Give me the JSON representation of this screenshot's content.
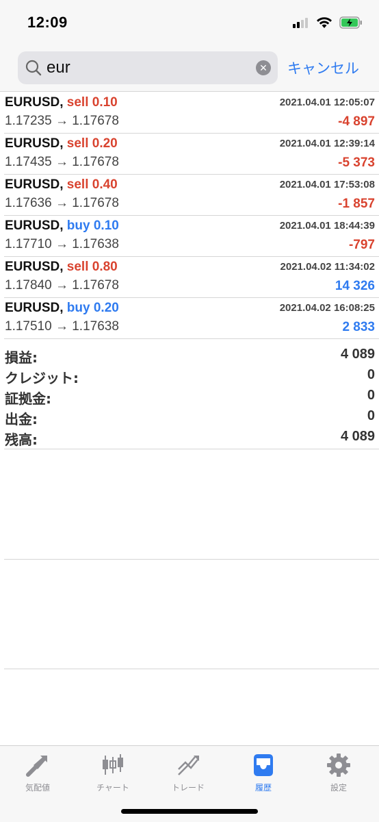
{
  "status_bar": {
    "time": "12:09"
  },
  "search": {
    "value": "eur",
    "placeholder": "",
    "cancel_label": "キャンセル"
  },
  "trades": [
    {
      "symbol": "EURUSD,",
      "type": "sell",
      "volume": "sell 0.10",
      "prices": "1.17235 → 1.17678",
      "time": "2021.04.01 12:05:07",
      "profit": "-4 897",
      "profit_sign": "neg"
    },
    {
      "symbol": "EURUSD,",
      "type": "sell",
      "volume": "sell 0.20",
      "prices": "1.17435 → 1.17678",
      "time": "2021.04.01 12:39:14",
      "profit": "-5 373",
      "profit_sign": "neg"
    },
    {
      "symbol": "EURUSD,",
      "type": "sell",
      "volume": "sell 0.40",
      "prices": "1.17636 → 1.17678",
      "time": "2021.04.01 17:53:08",
      "profit": "-1 857",
      "profit_sign": "neg"
    },
    {
      "symbol": "EURUSD,",
      "type": "buy",
      "volume": "buy 0.10",
      "prices": "1.17710 → 1.17638",
      "time": "2021.04.01 18:44:39",
      "profit": "-797",
      "profit_sign": "neg"
    },
    {
      "symbol": "EURUSD,",
      "type": "sell",
      "volume": "sell 0.80",
      "prices": "1.17840 → 1.17678",
      "time": "2021.04.02 11:34:02",
      "profit": "14 326",
      "profit_sign": "pos"
    },
    {
      "symbol": "EURUSD,",
      "type": "buy",
      "volume": "buy 0.20",
      "prices": "1.17510 → 1.17638",
      "time": "2021.04.02 16:08:25",
      "profit": "2 833",
      "profit_sign": "pos"
    }
  ],
  "summary": [
    {
      "label": "損益:",
      "value": "4 089"
    },
    {
      "label": "クレジット:",
      "value": "0"
    },
    {
      "label": "証拠金:",
      "value": "0"
    },
    {
      "label": "出金:",
      "value": "0"
    },
    {
      "label": "残高:",
      "value": "4 089"
    }
  ],
  "tabs": [
    {
      "label": "気配値",
      "icon": "quotes-icon",
      "active": false
    },
    {
      "label": "チャート",
      "icon": "chart-icon",
      "active": false
    },
    {
      "label": "トレード",
      "icon": "trade-icon",
      "active": false
    },
    {
      "label": "履歴",
      "icon": "history-icon",
      "active": true
    },
    {
      "label": "設定",
      "icon": "settings-icon",
      "active": false
    }
  ],
  "colors": {
    "sell": "#d9432f",
    "buy": "#2f7bf0",
    "accent": "#2f7bf0",
    "inactive": "#8e8e93"
  }
}
